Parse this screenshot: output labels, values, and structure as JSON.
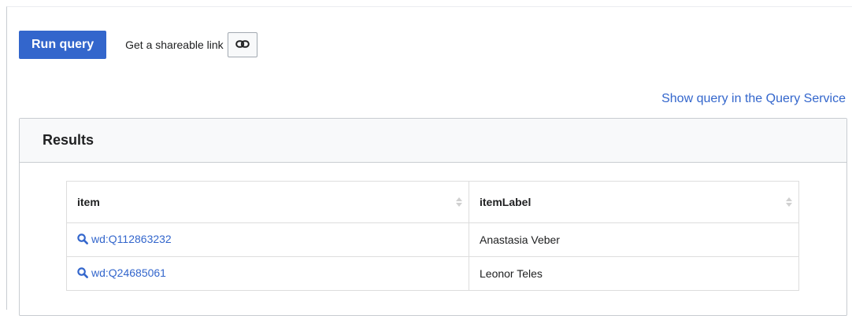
{
  "toolbar": {
    "run_label": "Run query",
    "share_label": "Get a shareable link",
    "share_icon": "link-icon"
  },
  "query_service_link": "Show query in the Query Service",
  "results": {
    "title": "Results",
    "columns": [
      "item",
      "itemLabel"
    ],
    "rows": [
      {
        "item": "wd:Q112863232",
        "itemLabel": "Anastasia Veber"
      },
      {
        "item": "wd:Q24685061",
        "itemLabel": "Leonor Teles"
      }
    ]
  },
  "colors": {
    "accent": "#3366cc",
    "border": "#c8ccd1",
    "header_bg": "#f8f9fa"
  }
}
